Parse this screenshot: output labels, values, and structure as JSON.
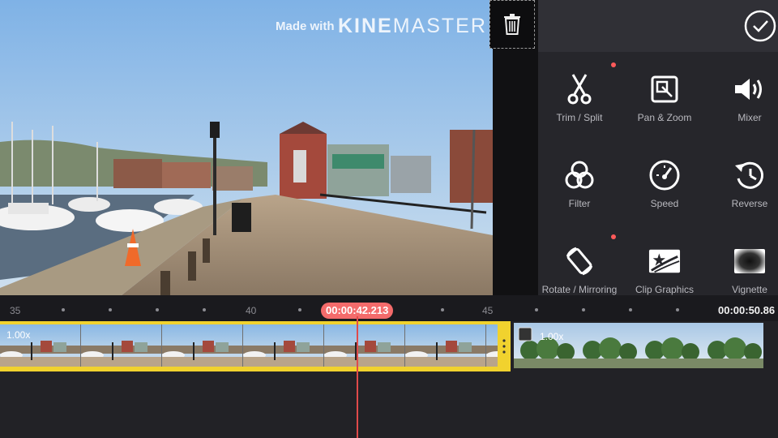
{
  "watermark": {
    "prefix": "Made with",
    "brand_bold": "KINE",
    "brand_rest": "MASTER"
  },
  "tools": [
    {
      "id": "trim",
      "label": "Trim / Split",
      "icon": "scissors-icon",
      "dot": true
    },
    {
      "id": "panzoom",
      "label": "Pan & Zoom",
      "icon": "pan-zoom-icon",
      "dot": false
    },
    {
      "id": "mixer",
      "label": "Mixer",
      "icon": "speaker-icon",
      "dot": false
    },
    {
      "id": "filter",
      "label": "Filter",
      "icon": "filter-icon",
      "dot": false
    },
    {
      "id": "speed",
      "label": "Speed",
      "icon": "speedometer-icon",
      "dot": false
    },
    {
      "id": "reverse",
      "label": "Reverse",
      "icon": "reverse-icon",
      "dot": false
    },
    {
      "id": "rotate",
      "label": "Rotate / Mirroring",
      "icon": "rotate-icon",
      "dot": true
    },
    {
      "id": "clipgraphics",
      "label": "Clip Graphics",
      "icon": "clip-graphics-icon",
      "dot": false
    },
    {
      "id": "vignette",
      "label": "Vignette",
      "icon": "vignette-icon",
      "dot": false
    }
  ],
  "ruler": {
    "labels": [
      "35",
      "40",
      "45"
    ]
  },
  "playhead_time": "00:00:42.213",
  "end_time": "00:00:50.86",
  "clips": [
    {
      "speed": "1.00x"
    },
    {
      "speed": "1.00x"
    }
  ],
  "colors": {
    "accent_yellow": "#f1d22e",
    "playhead": "#f46b6b",
    "notify_dot": "#ff5a5a"
  }
}
